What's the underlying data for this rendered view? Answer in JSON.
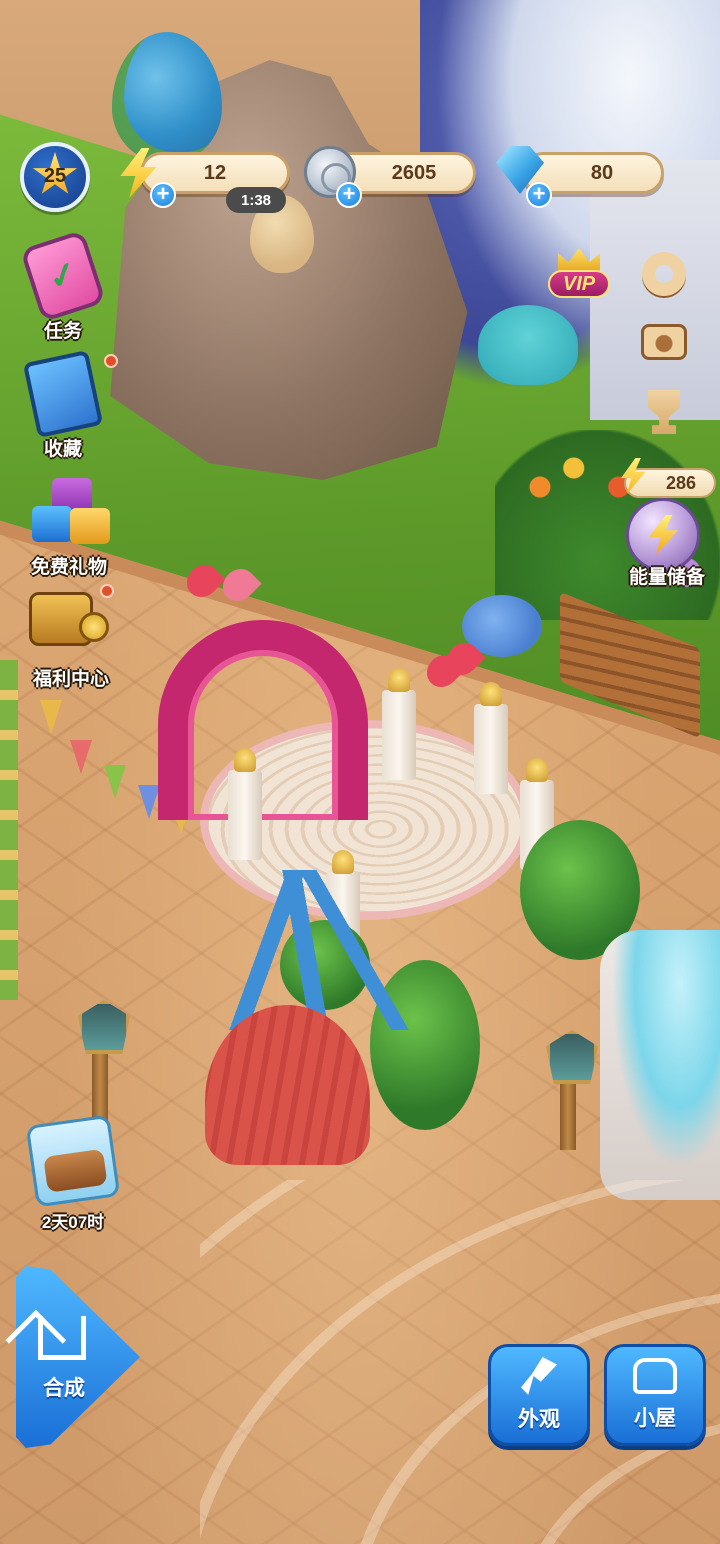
{
  "hud": {
    "level": "25",
    "energy": {
      "value": "12",
      "timer": "1:38",
      "add_label": "+"
    },
    "coins": {
      "value": "2605",
      "add_label": "+"
    },
    "gems": {
      "value": "80",
      "add_label": "+"
    }
  },
  "left_menu": [
    {
      "label": "任务",
      "icon": "phone-checklist-icon",
      "has_badge": false
    },
    {
      "label": "收藏",
      "icon": "album-book-icon",
      "has_badge": true
    },
    {
      "label": "免费礼物",
      "icon": "gift-boxes-icon",
      "has_badge": false
    },
    {
      "label": "福利中心",
      "icon": "treasure-chest-icon",
      "has_badge": true
    }
  ],
  "right_menu": {
    "vip_label": "VIP",
    "icons": [
      "gear-icon",
      "camera-icon",
      "trophy-icon"
    ]
  },
  "energy_store": {
    "count": "286",
    "label": "能量储备"
  },
  "event": {
    "time_left": "2天07时"
  },
  "bottom": {
    "merge_label": "合成",
    "appearance_label": "外观",
    "cabin_label": "小屋"
  },
  "colors": {
    "accent_blue": "#1d7fdc",
    "badge_red": "#e24d2a",
    "pill_cream": "#fff4df",
    "vip_pink": "#d83b8b"
  }
}
